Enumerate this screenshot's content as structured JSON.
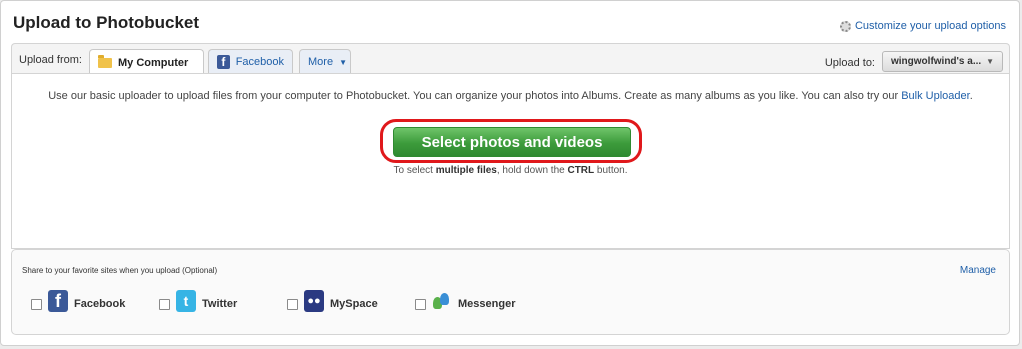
{
  "header": {
    "title": "Upload to Photobucket",
    "customize_link": "Customize your upload options",
    "customize_icon": "gear-icon"
  },
  "tabs": {
    "upload_from_label": "Upload from:",
    "items": [
      {
        "label": "My Computer",
        "icon": "folder-icon",
        "active": true
      },
      {
        "label": "Facebook",
        "icon": "facebook-icon",
        "active": false
      },
      {
        "label": "More",
        "icon": "chevron-down-icon",
        "active": false
      }
    ],
    "upload_to_label": "Upload to:",
    "upload_to_value": "wingwolfwind's a..."
  },
  "main": {
    "description": "Use our basic uploader to upload files from your computer to Photobucket. You can organize your photos into Albums. Create as many albums as you like. You can also try our",
    "bulk_link": "Bulk Uploader",
    "description_end": ".",
    "select_button": "Select photos and videos",
    "hint_prefix": "To select",
    "hint_bold1": "multiple files",
    "hint_mid": ", hold down the",
    "hint_bold2": "CTRL",
    "hint_suffix": "button."
  },
  "share": {
    "label": "Share to your favorite sites when you upload (Optional)",
    "manage": "Manage",
    "sites": [
      {
        "name": "Facebook",
        "icon": "facebook-logo-icon",
        "checked": false
      },
      {
        "name": "Twitter",
        "icon": "twitter-logo-icon",
        "checked": false
      },
      {
        "name": "MySpace",
        "icon": "myspace-logo-icon",
        "checked": false
      },
      {
        "name": "Messenger",
        "icon": "messenger-logo-icon",
        "checked": false
      }
    ]
  },
  "colors": {
    "link": "#1f5fa8",
    "button_green": "#3c9b3b",
    "highlight_red": "#e0181b"
  }
}
